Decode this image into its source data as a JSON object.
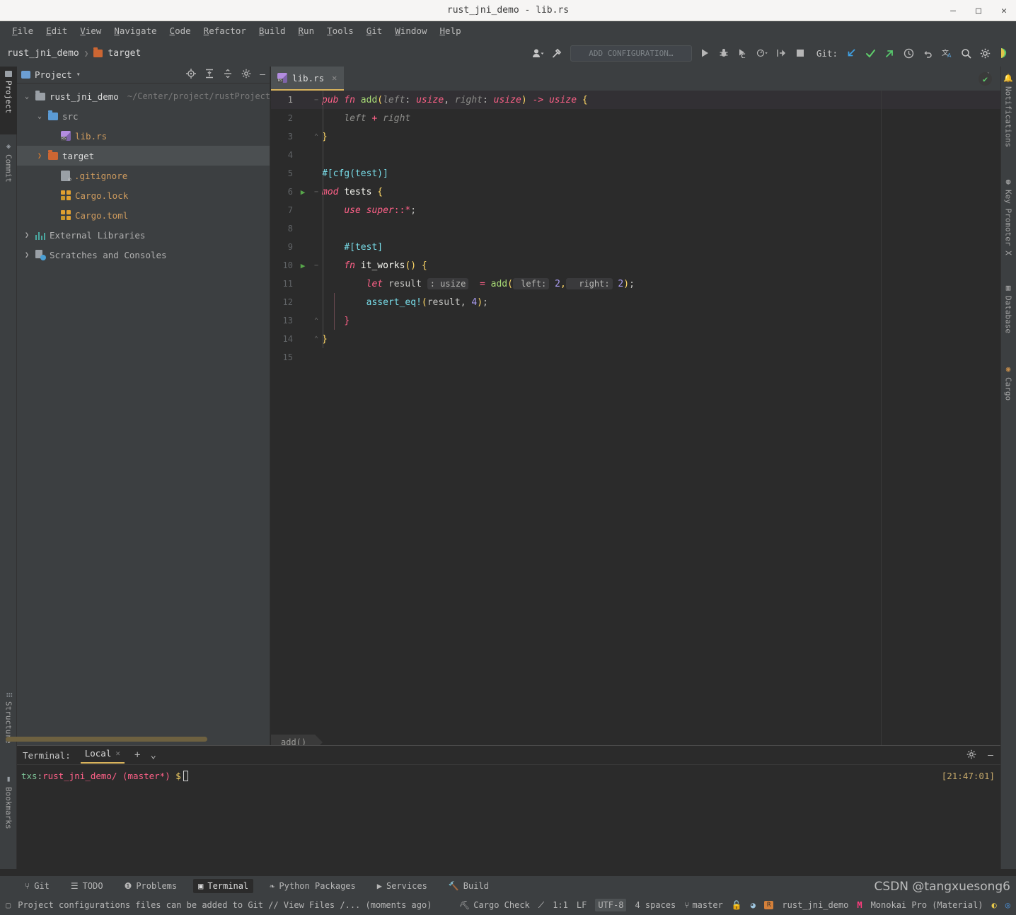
{
  "window": {
    "title": "rust_jni_demo - lib.rs",
    "minimize": "—",
    "maximize": "□",
    "close": "✕"
  },
  "menu": {
    "items": [
      "File",
      "Edit",
      "View",
      "Navigate",
      "Code",
      "Refactor",
      "Build",
      "Run",
      "Tools",
      "Git",
      "Window",
      "Help"
    ]
  },
  "toolbar": {
    "breadcrumb_project": "rust_jni_demo",
    "breadcrumb_sep": "❯",
    "breadcrumb_target": "target",
    "add_configuration": "ADD CONFIGURATION…",
    "git_label": "Git:",
    "icons": [
      "profile-icon",
      "hammer-icon",
      "run-icon",
      "debug-icon",
      "run-coverage-icon",
      "profiler-icon",
      "attach-icon",
      "stop-icon",
      "update-project-icon",
      "commit-icon",
      "push-icon",
      "history-icon",
      "rollback-icon",
      "translate-icon",
      "search-everywhere-icon",
      "settings-icon",
      "ide-icon"
    ]
  },
  "leftbar": {
    "tabs": [
      {
        "label": "Project",
        "icon": "project-icon",
        "active": true
      },
      {
        "label": "Commit",
        "icon": "commit-icon",
        "active": false
      },
      {
        "label": "Structure",
        "icon": "structure-icon",
        "active": false
      },
      {
        "label": "Bookmarks",
        "icon": "bookmark-icon",
        "active": false
      }
    ]
  },
  "rightbar": {
    "tabs": [
      {
        "label": "Notifications",
        "icon": "bell-icon"
      },
      {
        "label": "Key Promoter X",
        "icon": "keypromoter-icon"
      },
      {
        "label": "Database",
        "icon": "database-icon"
      },
      {
        "label": "Cargo",
        "icon": "cargo-icon"
      }
    ]
  },
  "project_panel": {
    "title": "Project",
    "dropdown": "▾",
    "tool_icons": [
      "locate-icon",
      "expand-all-icon",
      "collapse-all-icon",
      "gear-icon",
      "hide-icon"
    ],
    "tree": [
      {
        "label": "rust_jni_demo",
        "path": "~/Center/project/rustProject/ru",
        "icon": "folder-grey-icon",
        "arrow": "⌄",
        "indent": 0,
        "selected": false,
        "style": "white"
      },
      {
        "label": "src",
        "path": "",
        "icon": "folder-blue-icon",
        "arrow": "⌄",
        "indent": 1,
        "selected": false,
        "style": "grey"
      },
      {
        "label": "lib.rs",
        "path": "",
        "icon": "rust-file-icon",
        "arrow": "",
        "indent": 2,
        "selected": false,
        "style": "orange"
      },
      {
        "label": "target",
        "path": "",
        "icon": "folder-orange-icon",
        "arrow": "❯",
        "indent": 1,
        "selected": true,
        "style": "white"
      },
      {
        "label": ".gitignore",
        "path": "",
        "icon": "gitignore-file-icon",
        "arrow": "",
        "indent": 2,
        "selected": false,
        "style": "orange"
      },
      {
        "label": "Cargo.lock",
        "path": "",
        "icon": "cargo-lock-icon",
        "arrow": "",
        "indent": 2,
        "selected": false,
        "style": "orange"
      },
      {
        "label": "Cargo.toml",
        "path": "",
        "icon": "cargo-toml-icon",
        "arrow": "",
        "indent": 2,
        "selected": false,
        "style": "orange"
      },
      {
        "label": "External Libraries",
        "path": "",
        "icon": "libraries-icon",
        "arrow": "❯",
        "indent": 0,
        "selected": false,
        "style": "grey"
      },
      {
        "label": "Scratches and Consoles",
        "path": "",
        "icon": "scratches-icon",
        "arrow": "❯",
        "indent": 0,
        "selected": false,
        "style": "grey"
      }
    ]
  },
  "editor": {
    "tab": {
      "label": "lib.rs",
      "close": "✕",
      "icon": "rust-file-icon"
    },
    "menu_icon": "more-vertical-icon",
    "inspection_status": "✔",
    "breadcrumb_chip": "add()",
    "lines": [
      {
        "n": "1",
        "run": false,
        "fold": "−",
        "cur": true
      },
      {
        "n": "2",
        "run": false,
        "fold": "",
        "cur": false
      },
      {
        "n": "3",
        "run": false,
        "fold": "⌃",
        "cur": false
      },
      {
        "n": "4",
        "run": false,
        "fold": "",
        "cur": false
      },
      {
        "n": "5",
        "run": false,
        "fold": "",
        "cur": false
      },
      {
        "n": "6",
        "run": true,
        "fold": "−",
        "cur": false
      },
      {
        "n": "7",
        "run": false,
        "fold": "",
        "cur": false
      },
      {
        "n": "8",
        "run": false,
        "fold": "",
        "cur": false
      },
      {
        "n": "9",
        "run": false,
        "fold": "",
        "cur": false
      },
      {
        "n": "10",
        "run": true,
        "fold": "−",
        "cur": false
      },
      {
        "n": "11",
        "run": false,
        "fold": "",
        "cur": false
      },
      {
        "n": "12",
        "run": false,
        "fold": "",
        "cur": false
      },
      {
        "n": "13",
        "run": false,
        "fold": "⌃",
        "cur": false
      },
      {
        "n": "14",
        "run": false,
        "fold": "⌃",
        "cur": false
      },
      {
        "n": "15",
        "run": false,
        "fold": "",
        "cur": false
      }
    ],
    "source_text": "pub fn add(left: usize, right: usize) -> usize {\n    left + right\n}\n\n#[cfg(test)]\nmod tests {\n    use super::*;\n\n    #[test]\n    fn it_works() {\n        let result: usize = add(2, 2);\n        assert_eq!(result, 4);\n    }\n}\n"
  },
  "terminal": {
    "label": "Terminal:",
    "tab": "Local",
    "tab_close": "✕",
    "add": "+",
    "dropdown": "⌄",
    "settings_icon": "gear-icon",
    "hide_icon": "hide-icon",
    "prompt_user": "txs",
    "prompt_colon": ":",
    "prompt_path": "rust_jni_demo/",
    "prompt_branch": "(master*)",
    "prompt_dollar": "$",
    "timestamp": "[21:47:01]"
  },
  "toolwindows": [
    {
      "label": "Git",
      "icon": "git-icon",
      "active": false
    },
    {
      "label": "TODO",
      "icon": "todo-icon",
      "active": false
    },
    {
      "label": "Problems",
      "icon": "problems-icon",
      "active": false
    },
    {
      "label": "Terminal",
      "icon": "terminal-icon",
      "active": true
    },
    {
      "label": "Python Packages",
      "icon": "python-packages-icon",
      "active": false
    },
    {
      "label": "Services",
      "icon": "services-icon",
      "active": false
    },
    {
      "label": "Build",
      "icon": "build-icon",
      "active": false
    }
  ],
  "statusbar": {
    "message": "Project configurations files can be added to Git // View Files /... (moments ago)",
    "message_icon": "note-icon",
    "cargo_check": "Cargo Check",
    "cargo_check_icon": "cargo-check-icon",
    "inspection_icon": "inspection-icon",
    "caret": "1:1",
    "line_separator": "LF",
    "encoding": "UTF-8",
    "indent": "4 spaces",
    "branch": "master",
    "branch_icon": "branch-icon",
    "lock_icon": "lock-icon",
    "macro_icon": "macro-icon",
    "r_badge": "R",
    "project": "rust_jni_demo",
    "theme_mark": "M",
    "theme": "Monokai Pro (Material)",
    "watermark": "CSDN @tangxuesong6"
  },
  "colors": {
    "accent_orange": "#cc6633",
    "tab_underline": "#d8b35c",
    "keyword_pink": "#ff6188",
    "function_green": "#a9dc76",
    "number_purple": "#ab9df2",
    "attr_cyan": "#78dce8",
    "paren_yellow": "#ffd866",
    "panel_bg": "#3c3f41",
    "editor_bg": "#2b2b2b"
  }
}
